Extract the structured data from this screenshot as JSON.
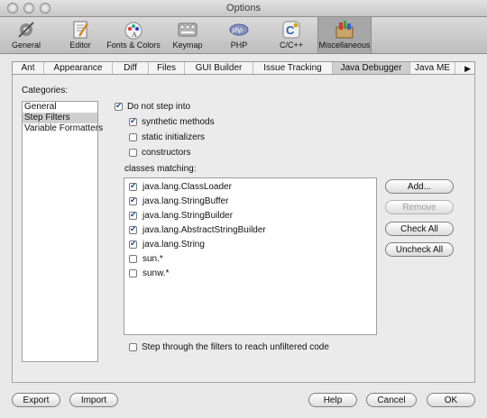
{
  "window": {
    "title": "Options"
  },
  "toolbar": {
    "items": [
      {
        "label": "General",
        "icon": "gear-icon"
      },
      {
        "label": "Editor",
        "icon": "editor-icon"
      },
      {
        "label": "Fonts & Colors",
        "icon": "palette-icon"
      },
      {
        "label": "Keymap",
        "icon": "keyboard-icon"
      },
      {
        "label": "PHP",
        "icon": "php-icon"
      },
      {
        "label": "C/C++",
        "icon": "cpp-icon"
      },
      {
        "label": "Miscellaneous",
        "icon": "misc-icon",
        "selected": true
      }
    ]
  },
  "tabs": {
    "items": [
      "Ant",
      "Appearance",
      "Diff",
      "Files",
      "GUI Builder",
      "Issue Tracking",
      "Java Debugger",
      "Java ME"
    ],
    "active": "Java Debugger"
  },
  "categories": {
    "label": "Categories:",
    "items": [
      "General",
      "Step Filters",
      "Variable Formatters"
    ],
    "selected": "Step Filters"
  },
  "step_filters": {
    "do_not_step_into": {
      "label": "Do not step into",
      "checked": true
    },
    "synthetic_methods": {
      "label": "synthetic methods",
      "checked": true
    },
    "static_initializers": {
      "label": "static initializers",
      "checked": false
    },
    "constructors": {
      "label": "constructors",
      "checked": false
    },
    "classes_label": "classes matching:",
    "classes": [
      {
        "name": "java.lang.ClassLoader",
        "checked": true
      },
      {
        "name": "java.lang.StringBuffer",
        "checked": true
      },
      {
        "name": "java.lang.StringBuilder",
        "checked": true
      },
      {
        "name": "java.lang.AbstractStringBuilder",
        "checked": true
      },
      {
        "name": "java.lang.String",
        "checked": true
      },
      {
        "name": "sun.*",
        "checked": false
      },
      {
        "name": "sunw.*",
        "checked": false
      }
    ],
    "step_through": {
      "label": "Step through the filters to reach unfiltered code",
      "checked": false
    }
  },
  "side_buttons": {
    "add": "Add...",
    "remove": "Remove",
    "check_all": "Check All",
    "uncheck_all": "Uncheck All"
  },
  "footer": {
    "export": "Export",
    "import": "Import",
    "help": "Help",
    "cancel": "Cancel",
    "ok": "OK"
  },
  "colors": {
    "accent": "#1d4f9a",
    "selection": "#cfcfcf",
    "window_bg": "#e8e8e8"
  }
}
